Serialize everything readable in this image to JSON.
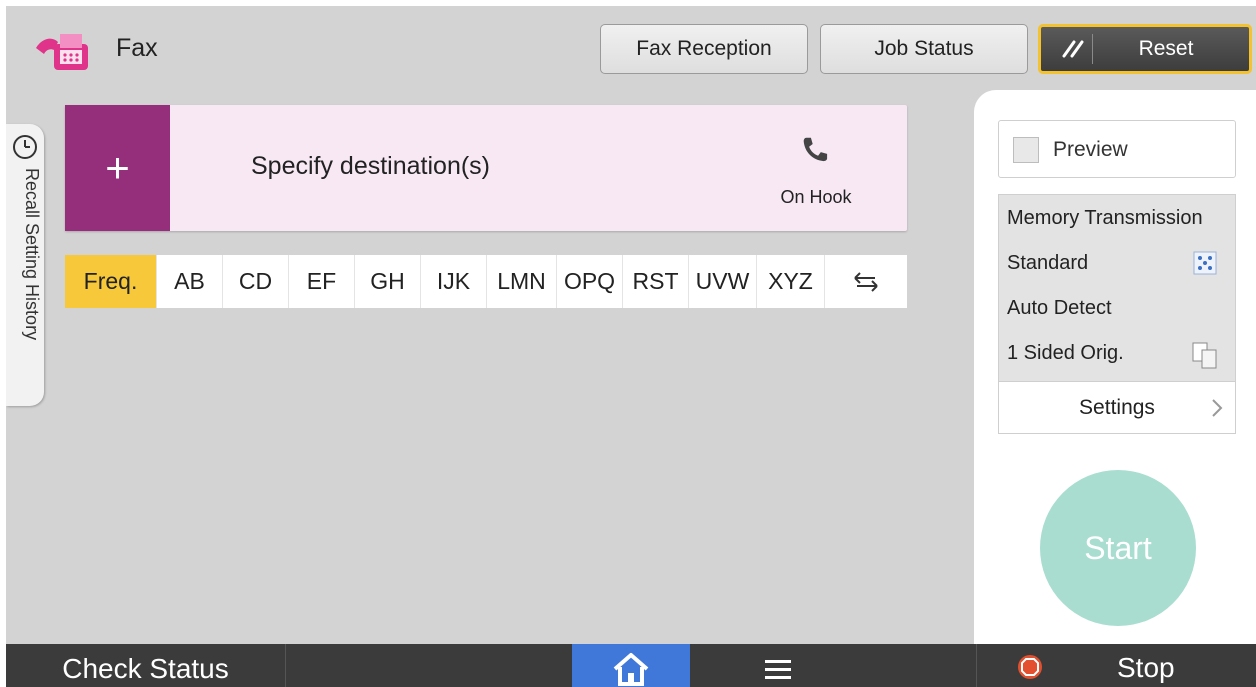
{
  "header": {
    "title": "Fax",
    "fax_reception_label": "Fax Reception",
    "job_status_label": "Job Status",
    "reset_label": "Reset"
  },
  "recall": {
    "label": "Recall Setting History"
  },
  "destination": {
    "add_symbol": "+",
    "label": "Specify destination(s)",
    "on_hook_label": "On Hook"
  },
  "index_tabs": [
    {
      "label": "Freq.",
      "active": true
    },
    {
      "label": "AB"
    },
    {
      "label": "CD"
    },
    {
      "label": "EF"
    },
    {
      "label": "GH"
    },
    {
      "label": "IJK"
    },
    {
      "label": "LMN"
    },
    {
      "label": "OPQ"
    },
    {
      "label": "RST"
    },
    {
      "label": "UVW"
    },
    {
      "label": "XYZ"
    }
  ],
  "right_panel": {
    "preview_label": "Preview",
    "preview_checked": false,
    "transmission_mode": "Memory Transmission",
    "resolution": "Standard",
    "original_type": "Auto Detect",
    "sides": "1 Sided Orig.",
    "settings_label": "Settings",
    "start_label": "Start"
  },
  "bottom_bar": {
    "check_status_label": "Check Status",
    "stop_label": "Stop"
  },
  "colors": {
    "accent_purple": "#952f7b",
    "active_tab_yellow": "#f7c93a",
    "start_green": "#a8ddd0",
    "home_blue": "#3f78d9",
    "reset_border": "#f2c230"
  },
  "icons": {
    "app": "fax-machine-icon",
    "reset": "reset-slash-icon",
    "recall": "clock-icon",
    "phone": "phone-handset-icon",
    "switch": "swap-arrows-icon",
    "resolution": "resolution-icon",
    "duplex": "duplex-icon",
    "chevron": "chevron-right-icon",
    "home": "home-icon",
    "menu": "menu-icon",
    "stop": "stop-icon"
  }
}
